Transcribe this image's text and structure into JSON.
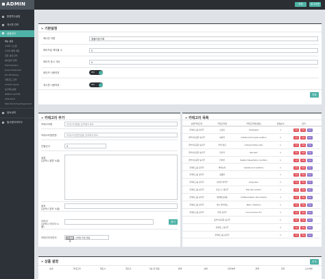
{
  "topbar": {
    "brand": "ADMIN",
    "buttons": [
      "저장",
      "로그아웃"
    ]
  },
  "sidebar": {
    "items": [
      {
        "label": "환경변수설정",
        "active": false
      },
      {
        "label": "게시판 관리",
        "active": false
      },
      {
        "label": "설정관리",
        "active": true
      }
    ],
    "subitems": [
      "메뉴 설정",
      "수치리 시스템",
      "수치리 결제 세팅",
      "권한 설정 관리",
      "배너관리 정책",
      "Point Reward",
      "Event Extension",
      "DS Attributes",
      "쿠폰코드 관리",
      "Activity Spots",
      "호출메뉴설정",
      "DEBUG ACTIVE",
      "CMS Build",
      "Manufacturing Equipment"
    ],
    "bottom_items": [
      {
        "label": "접속내역"
      },
      {
        "label": "필사원리이미지"
      }
    ]
  },
  "basic": {
    "title": "기본설정",
    "fields": [
      {
        "label": "제너런 이름",
        "value": "결플러링기록"
      },
      {
        "label": "레이즈값 케이블 수",
        "value": "0"
      },
      {
        "label": "레이즈 표시 개수",
        "value": "0"
      }
    ],
    "toggles": [
      {
        "label": "레이즈 사용여부",
        "state": "ON"
      },
      {
        "label": "게시판 사용여부",
        "state": "ON"
      }
    ],
    "save_label": "저장"
  },
  "category_form": {
    "title": "카테고리 추가",
    "fields": [
      {
        "label": "카테고리명",
        "placeholder": "카테고리명을 입력해주세요"
      },
      {
        "label": "카테고리영문명",
        "placeholder": "카테고리영문명을 입력해주세요"
      },
      {
        "label": "진열순서",
        "value": "0"
      }
    ],
    "textareas": [
      {
        "label": "설명\n(입력시 설명 노출)"
      },
      {
        "label": "참조\n(입력시 참조 노출)"
      }
    ],
    "image_label": "이미지\n(입력시 이미지 노출)",
    "image_button": "찾기",
    "file_label": "카테고리이미지",
    "file_button": "파일 선택",
    "file_text": "선택된 파일 없음"
  },
  "category_list": {
    "title": "카테고리 목록",
    "headers": [
      "상위카테고리",
      "카테고리명",
      "카테고리명(영문)",
      "진열순서",
      "관리"
    ],
    "rows": [
      {
        "parent": "플레이그룹 정기투",
        "name": "스피릿",
        "en": "Strategist",
        "order": "1",
        "actions": [
          "수정",
          "삭제",
          "추가"
        ]
      },
      {
        "parent": "글부이기공유 링기투",
        "name": "여정학",
        "en": "Infinitive Principle Audition",
        "order": "1",
        "actions": [
          "수정",
          "삭제",
          "추가"
        ]
      },
      {
        "parent": "글부이기공유 링기투",
        "name": "부의 편집",
        "en": "Ambient Note Auto",
        "order": "1",
        "actions": [
          "수정",
          "삭제",
          "추가"
        ]
      },
      {
        "parent": "글부이기공유 링기투",
        "name": "철거학",
        "en": "Bachert",
        "order": "1",
        "actions": [
          "수정",
          "삭제",
          "추가"
        ]
      },
      {
        "parent": "글부이기공유 링기투",
        "name": "인터뷰",
        "en": "Spatial Dissertation Audition",
        "order": "1",
        "actions": [
          "수정",
          "삭제",
          "추가"
        ]
      },
      {
        "parent": "플레이그룹 정기투",
        "name": "발언논리",
        "en": "Update and Audition",
        "order": "1",
        "actions": [
          "수정",
          "삭제",
          "추가"
        ]
      },
      {
        "parent": "플레이그룹 정기투",
        "name": "공용면",
        "en": "",
        "order": "1",
        "actions": [
          "수정",
          "삭제",
          "추가"
        ]
      },
      {
        "parent": "플레이그룹 정기투",
        "name": "간편한 외부투",
        "en": "Organizer",
        "order": "1",
        "actions": [
          "수정",
          "삭제",
          "추가"
        ]
      },
      {
        "parent": "플레이그룹 정기투",
        "name": "건조기 / 세기투",
        "en": "Biscuits Auditor",
        "order": "1",
        "actions": [
          "수정",
          "삭제",
          "추가"
        ]
      },
      {
        "parent": "플레이그룹 정기투",
        "name": "매개변조이용",
        "en": "Software Basic Documents",
        "order": "1",
        "actions": [
          "수정",
          "삭제",
          "추가"
        ]
      },
      {
        "parent": "플레이그룹 정기투",
        "name": "레시 아키텍트",
        "en": "Basic Interface",
        "order": "1",
        "actions": [
          "수정",
          "삭제",
          "추가"
        ]
      },
      {
        "parent": "플레이그룹 정기투",
        "name": "플레 정기투",
        "en": "Concordance Fin",
        "order": "1",
        "actions": [
          "수정",
          "삭제",
          "추가"
        ]
      },
      {
        "parent": "",
        "name": "공부이기공유 링기투",
        "en": "",
        "order": "1",
        "actions": [
          "수정",
          "삭제",
          "추가"
        ]
      },
      {
        "parent": "",
        "name": "플레이그 정기투",
        "en": "",
        "order": "1",
        "actions": [
          "수정",
          "삭제",
          "추가"
        ]
      },
      {
        "parent": "",
        "name": "플레이그룹 정기투",
        "en": "",
        "order": "1",
        "actions": [
          "수정",
          "삭제",
          "추가"
        ]
      }
    ]
  },
  "bottom": {
    "title": "상품 설정",
    "button": "추가",
    "headers": [
      "순번",
      "카테고리",
      "제조사",
      "제조사",
      "가능 한 대로",
      "금액",
      "상태",
      "관리여부",
      "금액",
      "관리",
      "노출여부"
    ]
  },
  "colors": {
    "accent": "#4fb2a6",
    "sidebar": "#2d3238",
    "topbar": "#2b2f33",
    "danger": "#e0515a",
    "purple": "#8c75c9"
  }
}
